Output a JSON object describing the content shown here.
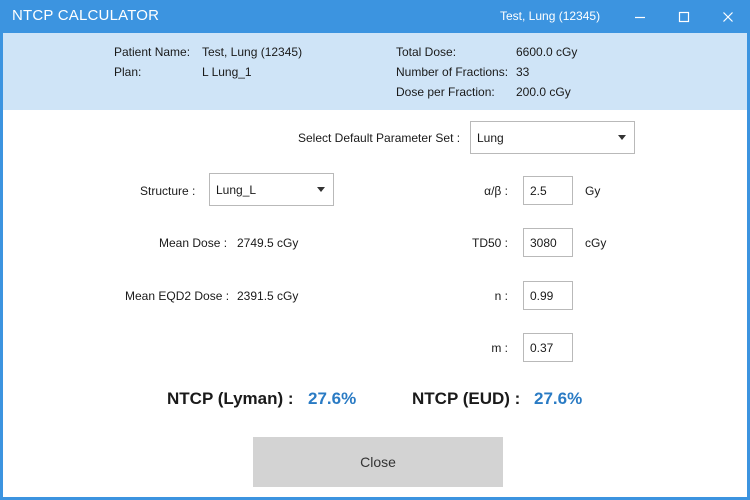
{
  "window": {
    "title": "NTCP CALCULATOR",
    "patient_title": "Test, Lung (12345)",
    "controls": {
      "minimize": "minimize-icon",
      "maximize": "maximize-icon",
      "close": "close-icon"
    },
    "accent_color": "#3c94e0",
    "info_background": "#cfe4f7"
  },
  "info": {
    "patient_name_label": "Patient Name:",
    "patient_name": "Test, Lung (12345)",
    "plan_label": "Plan:",
    "plan": "L Lung_1",
    "total_dose_label": "Total Dose:",
    "total_dose": "6600.0 cGy",
    "fractions_label": "Number of Fractions:",
    "fractions": "33",
    "dose_per_fraction_label": "Dose per Fraction:",
    "dose_per_fraction": "200.0 cGy"
  },
  "params": {
    "parameter_set_label": "Select Default Parameter Set :",
    "parameter_set_value": "Lung",
    "alpha_beta_label": "α/β :",
    "alpha_beta_value": "2.5",
    "alpha_beta_unit": "Gy",
    "td50_label": "TD50 :",
    "td50_value": "3080",
    "td50_unit": "cGy",
    "n_label": "n :",
    "n_value": "0.99",
    "m_label": "m :",
    "m_value": "0.37"
  },
  "structure": {
    "label": "Structure :",
    "value": "Lung_L",
    "mean_dose_label": "Mean Dose :",
    "mean_dose_value": "2749.5 cGy",
    "mean_eqd2_label": "Mean EQD2 Dose :",
    "mean_eqd2_value": "2391.5 cGy"
  },
  "results": {
    "lyman_label": "NTCP (Lyman) :",
    "lyman_value": "27.6%",
    "eud_label": "NTCP (EUD) :",
    "eud_value": "27.6%",
    "value_color": "#2a7bc4"
  },
  "actions": {
    "close_label": "Close"
  }
}
